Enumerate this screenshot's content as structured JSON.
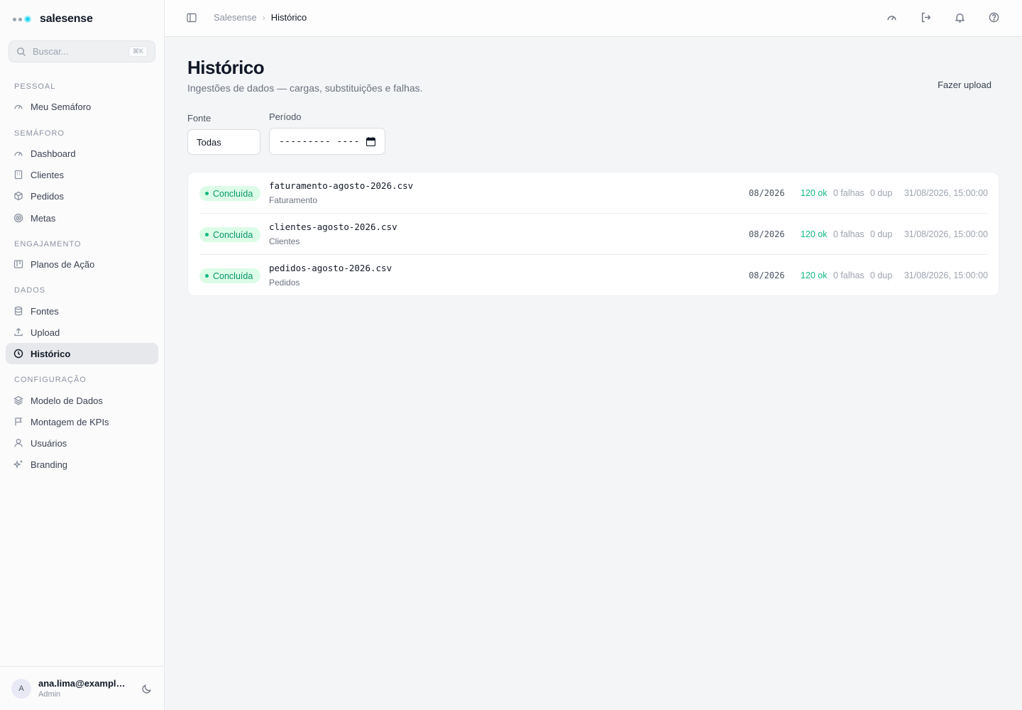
{
  "brand": {
    "name": "salesense"
  },
  "search": {
    "placeholder": "Buscar...",
    "shortcut": "⌘K"
  },
  "sidebar": {
    "sections": [
      {
        "title": "PESSOAL",
        "items": [
          {
            "label": "Meu Semáforo",
            "icon": "gauge-icon"
          }
        ]
      },
      {
        "title": "SEMÁFORO",
        "items": [
          {
            "label": "Dashboard",
            "icon": "gauge-icon"
          },
          {
            "label": "Clientes",
            "icon": "building-icon"
          },
          {
            "label": "Pedidos",
            "icon": "package-icon"
          },
          {
            "label": "Metas",
            "icon": "target-icon"
          }
        ]
      },
      {
        "title": "ENGAJAMENTO",
        "items": [
          {
            "label": "Planos de Ação",
            "icon": "kanban-icon"
          }
        ]
      },
      {
        "title": "DADOS",
        "items": [
          {
            "label": "Fontes",
            "icon": "database-icon"
          },
          {
            "label": "Upload",
            "icon": "upload-icon"
          },
          {
            "label": "Histórico",
            "icon": "clock-icon",
            "active": true
          }
        ]
      },
      {
        "title": "CONFIGURAÇÃO",
        "items": [
          {
            "label": "Modelo de Dados",
            "icon": "layers-icon"
          },
          {
            "label": "Montagem de KPIs",
            "icon": "flag-icon"
          },
          {
            "label": "Usuários",
            "icon": "user-icon"
          },
          {
            "label": "Branding",
            "icon": "sparkles-icon"
          }
        ]
      }
    ]
  },
  "user": {
    "initial": "A",
    "email": "ana.lima@example.com",
    "role": "Admin"
  },
  "topbar": {
    "breadcrumb_root": "Salesense",
    "breadcrumb_current": "Histórico",
    "icons": [
      "gauge-icon",
      "logout-icon",
      "bell-icon",
      "help-icon"
    ]
  },
  "page": {
    "title": "Histórico",
    "subtitle": "Ingestões de dados — cargas, substituições e falhas.",
    "upload_label": "Fazer upload"
  },
  "filters": {
    "source_label": "Fonte",
    "source_value": "Todas",
    "period_label": "Período",
    "period_value": "--------- ----"
  },
  "ingestions": [
    {
      "status": "Concluída",
      "file": "faturamento-agosto-2026.csv",
      "source": "Faturamento",
      "period": "08/2026",
      "ok": "120 ok",
      "failures": "0 falhas",
      "dup": "0 dup",
      "timestamp": "31/08/2026, 15:00:00"
    },
    {
      "status": "Concluída",
      "file": "clientes-agosto-2026.csv",
      "source": "Clientes",
      "period": "08/2026",
      "ok": "120 ok",
      "failures": "0 falhas",
      "dup": "0 dup",
      "timestamp": "31/08/2026, 15:00:00"
    },
    {
      "status": "Concluída",
      "file": "pedidos-agosto-2026.csv",
      "source": "Pedidos",
      "period": "08/2026",
      "ok": "120 ok",
      "failures": "0 falhas",
      "dup": "0 dup",
      "timestamp": "31/08/2026, 15:00:00"
    }
  ],
  "colors": {
    "accent": "#22d3ee",
    "success": "#10b981",
    "success_bg": "#dcfce7",
    "active_nav": "#e6e8eb"
  }
}
